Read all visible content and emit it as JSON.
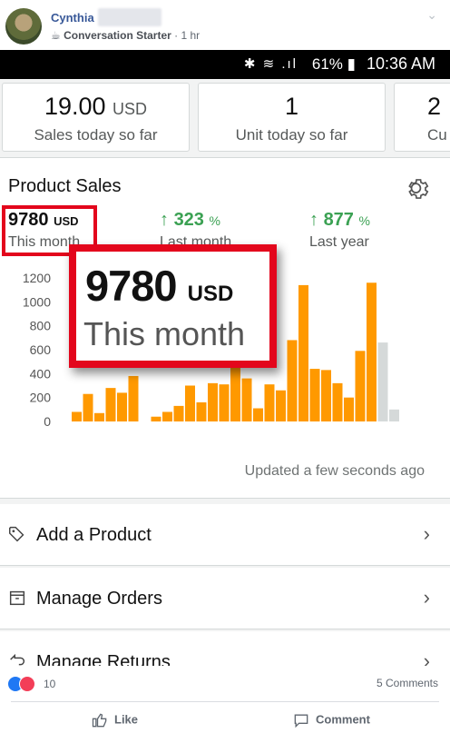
{
  "post": {
    "author": "Cynthia",
    "group_badge_icon": "coffee-icon",
    "badge": "Conversation Starter",
    "separator": "·",
    "time": "1 hr"
  },
  "status_bar": {
    "battery": "61%",
    "time": "10:36 AM"
  },
  "summary_cards": [
    {
      "value": "19.00",
      "unit": "USD",
      "label": "Sales today so far"
    },
    {
      "value": "1",
      "unit": "",
      "label": "Unit today so far"
    },
    {
      "value": "2",
      "unit": "",
      "label": "Cu"
    }
  ],
  "product_sales": {
    "title": "Product Sales",
    "this_month_value": "9780",
    "this_month_unit": "USD",
    "this_month_label": "This month",
    "last_month_value": "323",
    "last_month_unit": "%",
    "last_month_label": "Last month",
    "last_year_value": "877",
    "last_year_unit": "%",
    "last_year_label": "Last year",
    "updated": "Updated a few seconds ago",
    "accent": "#f90",
    "gray_bar": "#d5d9d9",
    "positive_color": "#3ba153",
    "highlight_color": "#e3061c"
  },
  "zoom_callout": {
    "value": "9780",
    "unit": "USD",
    "label": "This month"
  },
  "chart_data": {
    "type": "bar",
    "ylim": [
      0,
      1200
    ],
    "yticks": [
      "1200",
      "1000",
      "800",
      "600",
      "400",
      "200",
      "0"
    ],
    "values": [
      80,
      230,
      70,
      280,
      240,
      380,
      null,
      40,
      80,
      130,
      300,
      160,
      320,
      310,
      460,
      360,
      110,
      310,
      260,
      680,
      1140,
      440,
      430,
      320,
      200,
      590,
      1160,
      660,
      100
    ],
    "gray_index": [
      27,
      28
    ]
  },
  "actions": [
    {
      "label": "Add a Product",
      "icon": "tag-icon"
    },
    {
      "label": "Manage Orders",
      "icon": "box-icon"
    },
    {
      "label": "Manage Returns",
      "icon": "return-icon"
    }
  ],
  "footer": {
    "reaction_count": "10",
    "comments": "5 Comments",
    "like_label": "Like",
    "comment_label": "Comment",
    "like_color": "#2078f4",
    "love_color": "#f33e58"
  }
}
